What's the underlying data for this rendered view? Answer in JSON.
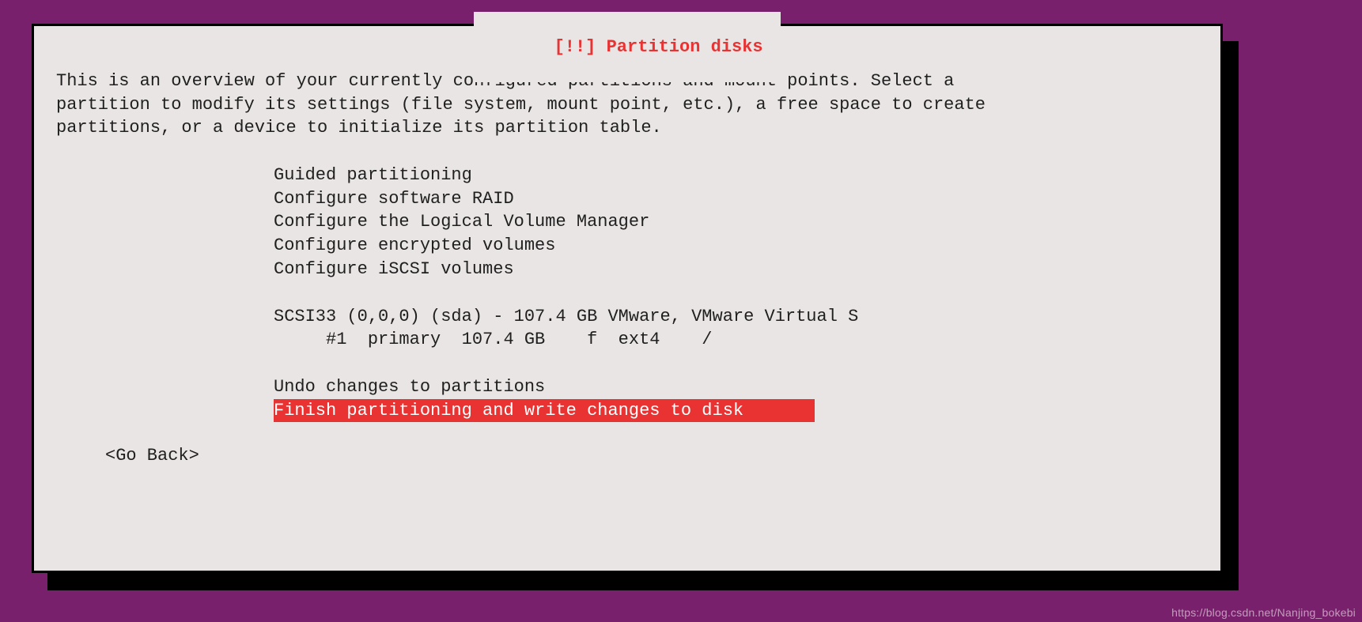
{
  "title": {
    "mark": "[!!]",
    "text": "Partition disks"
  },
  "intro": "This is an overview of your currently configured partitions and mount points. Select a\npartition to modify its settings (file system, mount point, etc.), a free space to create\npartitions, or a device to initialize its partition table.",
  "menu": {
    "guided": "Guided partitioning",
    "raid": "Configure software RAID",
    "lvm": "Configure the Logical Volume Manager",
    "encrypted": "Configure encrypted volumes",
    "iscsi": "Configure iSCSI volumes",
    "disk_line": "SCSI33 (0,0,0) (sda) - 107.4 GB VMware, VMware Virtual S",
    "partition_line": "     #1  primary  107.4 GB    f  ext4    /",
    "undo": "Undo changes to partitions",
    "finish": "Finish partitioning and write changes to disk"
  },
  "go_back": "<Go Back>",
  "watermark": "https://blog.csdn.net/Nanjing_bokebi"
}
